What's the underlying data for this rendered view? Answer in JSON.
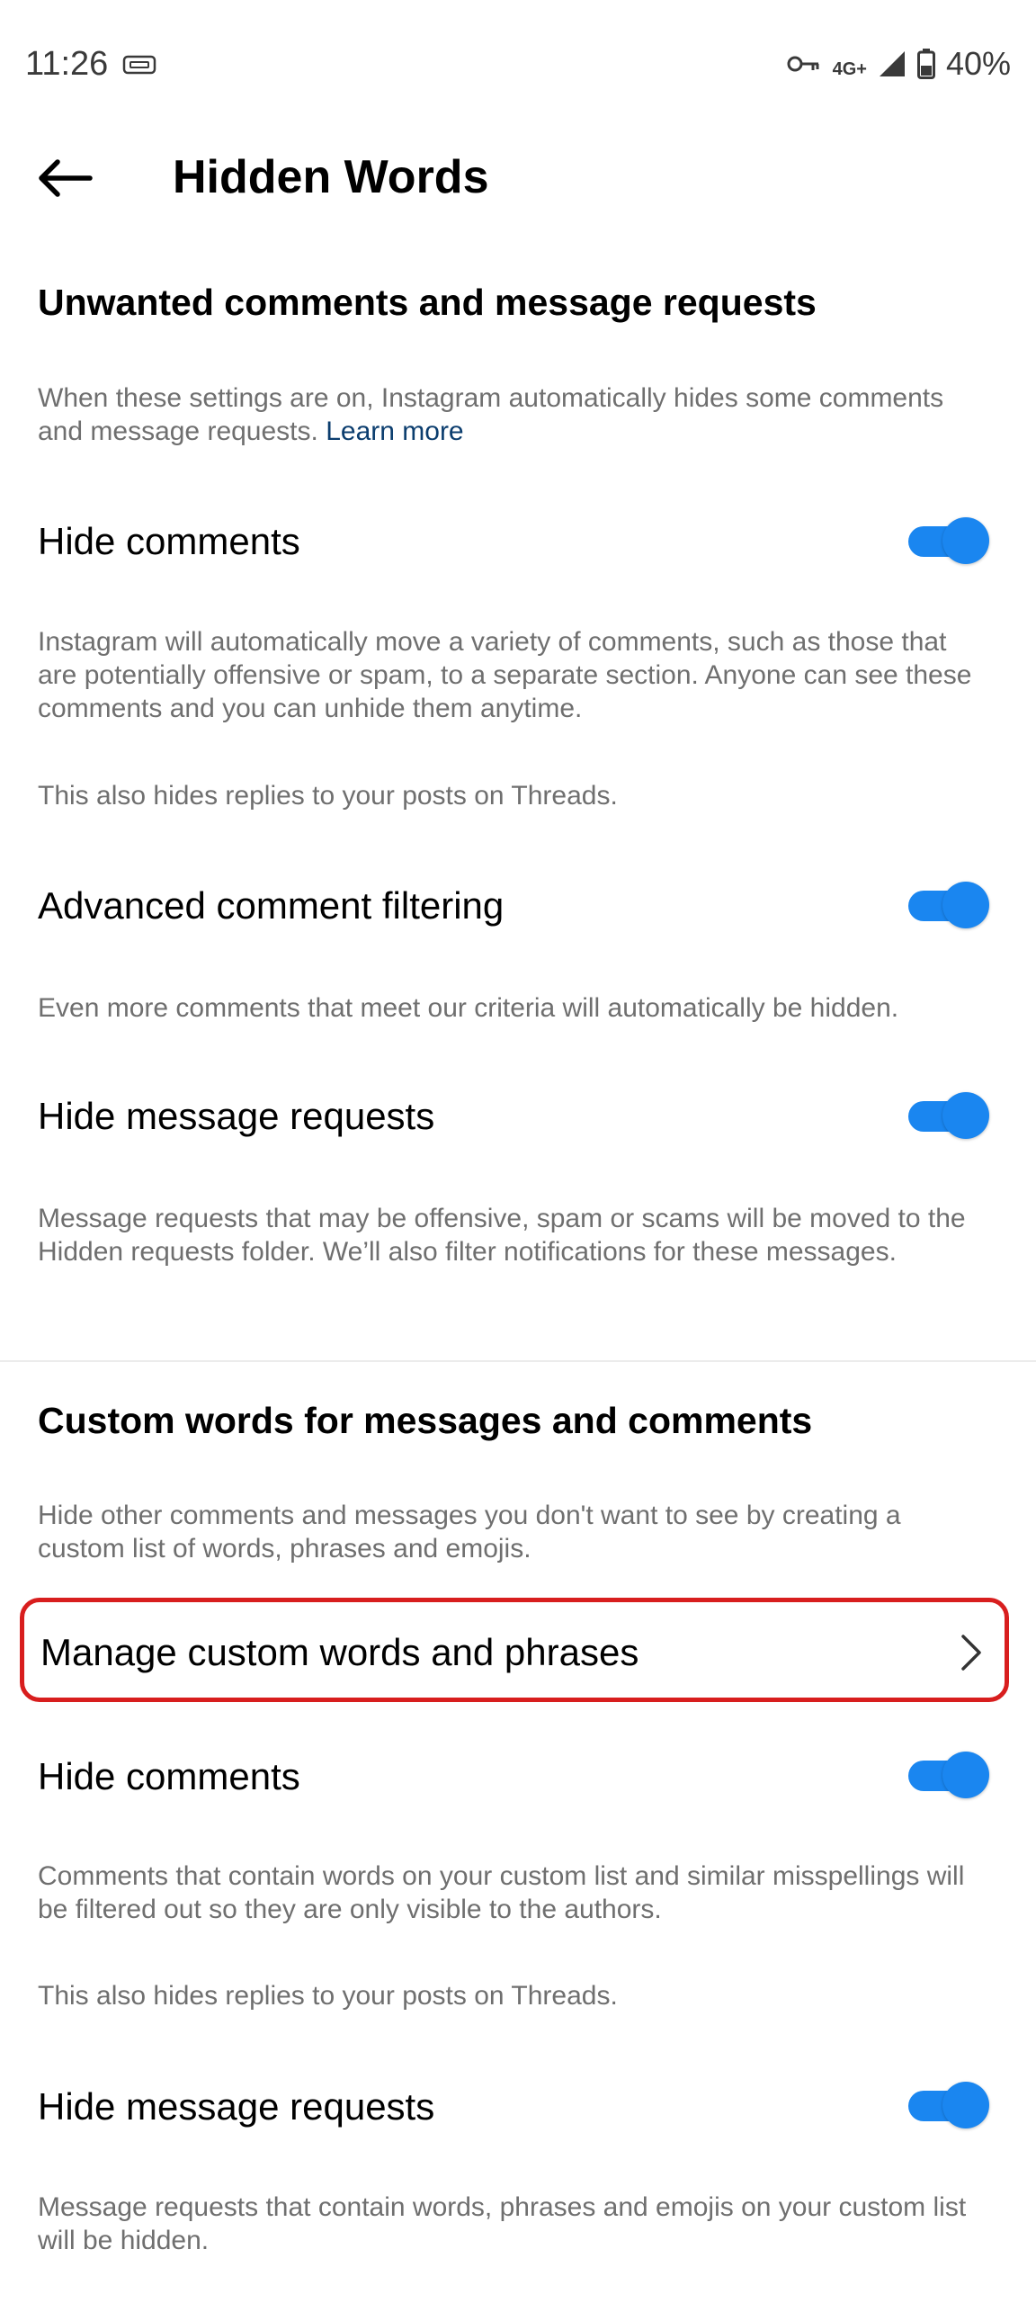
{
  "status_bar": {
    "time": "11:26",
    "network": "4G+",
    "battery": "40%"
  },
  "header": {
    "title": "Hidden Words"
  },
  "unwanted": {
    "heading": "Unwanted comments and message requests",
    "description": "When these settings are on, Instagram automatically hides some comments and message requests.",
    "learn_more": "Learn more",
    "items": [
      {
        "label": "Hide comments",
        "enabled": true,
        "description": "Instagram will automatically move a variety of comments, such as those that are potentially offensive or spam, to a separate section. Anyone can see these comments and you can unhide them anytime.",
        "note": "This also hides replies to your posts on Threads."
      },
      {
        "label": "Advanced comment filtering",
        "enabled": true,
        "description": "Even more comments that meet our criteria will automatically be hidden."
      },
      {
        "label": "Hide message requests",
        "enabled": true,
        "description": "Message requests that may be offensive, spam or scams will be moved to the Hidden requests folder. We’ll also filter notifications for these messages."
      }
    ]
  },
  "custom": {
    "heading": "Custom words for messages and comments",
    "description": "Hide other comments and messages you don't want to see by creating a custom list of words, phrases and emojis.",
    "manage_label": "Manage custom words and phrases",
    "items": [
      {
        "label": "Hide comments",
        "enabled": true,
        "description": "Comments that contain words on your custom list and similar misspellings will be filtered out so they are only visible to the authors.",
        "note": "This also hides replies to your posts on Threads."
      },
      {
        "label": "Hide message requests",
        "enabled": true,
        "description": "Message requests that contain words, phrases and emojis on your custom list will be hidden."
      }
    ]
  },
  "colors": {
    "toggle_on": "#1a86f0",
    "link": "#0b3d6e",
    "highlight_border": "#d81e1e",
    "secondary_text": "#6f6f6f"
  },
  "icons": {
    "back": "arrow-left-icon",
    "chevron": "chevron-right-icon",
    "vpn": "vpn-icon",
    "key": "key-icon",
    "signal": "signal-icon",
    "battery": "battery-icon"
  }
}
